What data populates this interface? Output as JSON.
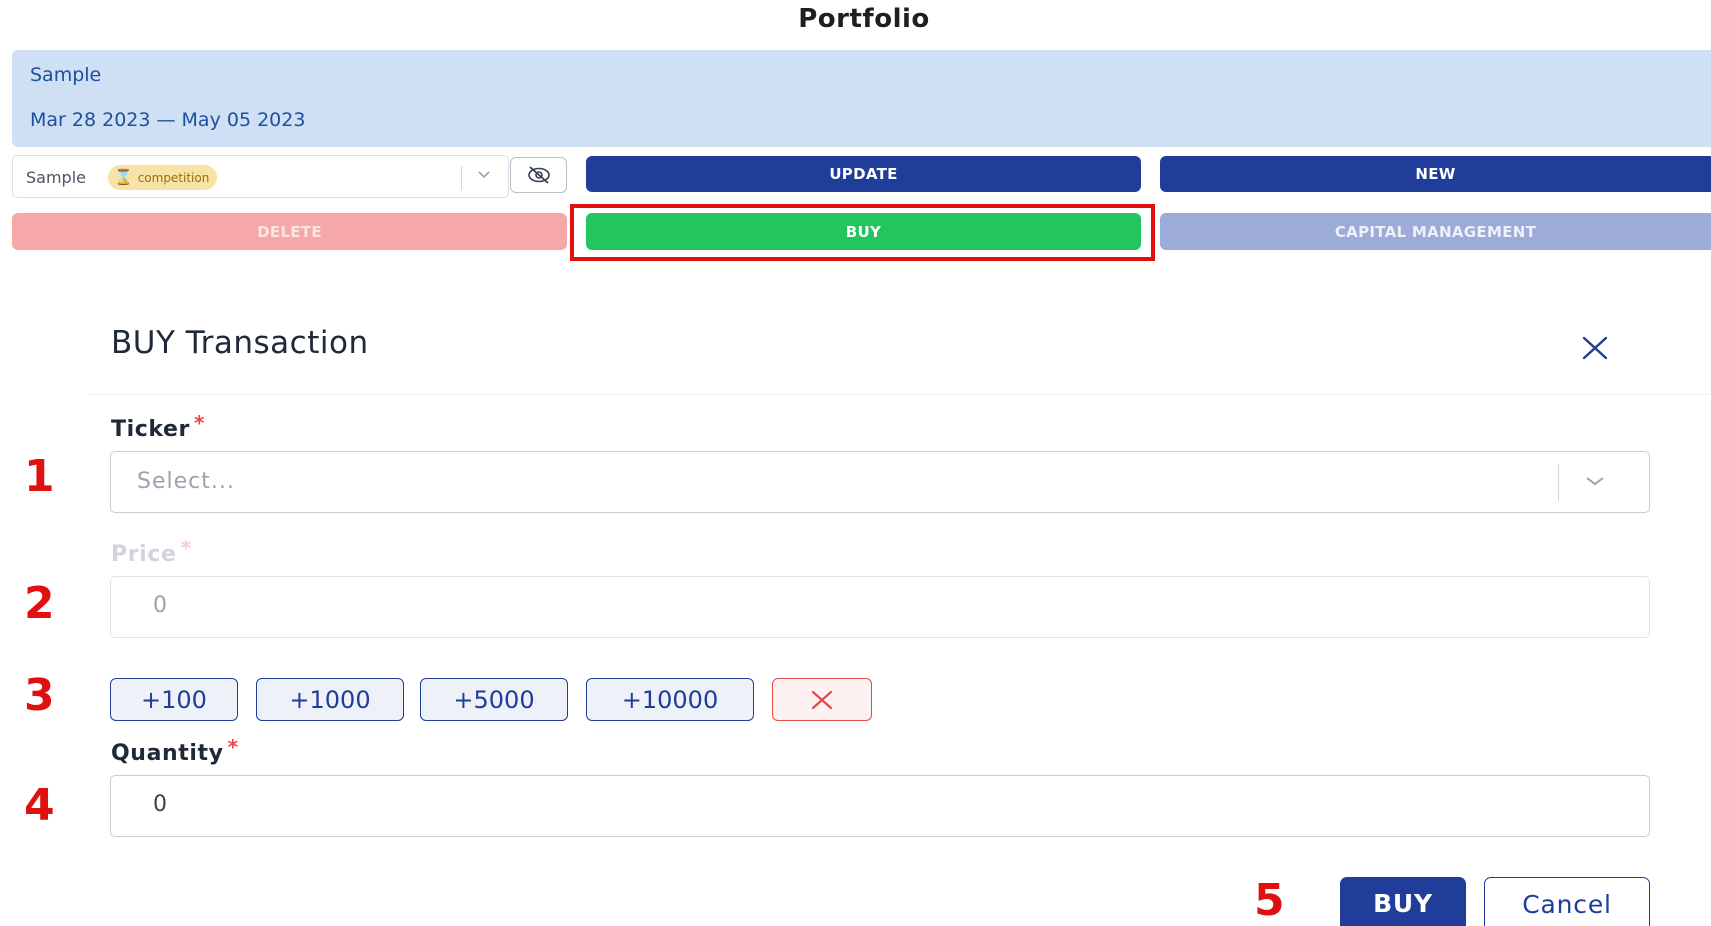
{
  "page": {
    "title": "Portfolio"
  },
  "portfolio_info": {
    "name": "Sample",
    "date_range": "Mar 28 2023 — May 05 2023"
  },
  "portfolio_select": {
    "value": "Sample",
    "badge_label": "competition",
    "badge_icon": "hourglass-icon"
  },
  "toolbar": {
    "update_label": "UPDATE",
    "new_label": "NEW",
    "delete_label": "DELETE",
    "buy_label": "BUY",
    "capital_label": "CAPITAL MANAGEMENT"
  },
  "modal": {
    "title": "BUY Transaction",
    "ticker": {
      "label": "Ticker",
      "required_mark": "*",
      "placeholder": "Select..."
    },
    "price": {
      "label": "Price",
      "required_mark": "*",
      "value": "0"
    },
    "quick_add": [
      "+100",
      "+1000",
      "+5000",
      "+10000"
    ],
    "quantity": {
      "label": "Quantity",
      "required_mark": "*",
      "value": "0"
    },
    "submit_label": "BUY",
    "cancel_label": "Cancel"
  },
  "annotations": {
    "step_1": "1",
    "step_2": "2",
    "step_3": "3",
    "step_4": "4",
    "step_5": "5"
  },
  "colors": {
    "primary": "#1f3d99",
    "success": "#22c55e",
    "danger_soft": "#f6a8a8",
    "info_bg": "#cfe0f4",
    "annotation_red": "#e01010"
  }
}
